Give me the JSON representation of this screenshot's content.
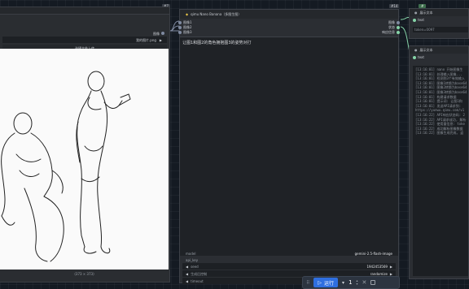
{
  "colors": {
    "accent": "#2f6fe0",
    "bg": "#141a22",
    "node": "#2b2e33",
    "link_green": "#86d4a8",
    "badge_green": "#3f6f4e"
  },
  "badges": {
    "top": "#7",
    "right": "#14",
    "right_small": "#"
  },
  "load_node": {
    "file_value": "我的图片.png",
    "upload_label": "选择文件上传",
    "image_size": "(373 × 373)",
    "edge_label": "图像"
  },
  "nano_node": {
    "title": "qimu Nano Banana（多图生图）",
    "inputs": [
      "图像1",
      "图像2",
      "图像3"
    ],
    "outputs": [
      "图像",
      "状态",
      "响应信息"
    ],
    "prompt": "让图1和图2的角色拥抱图3的姿势对打",
    "params": [
      {
        "label": "model",
        "value": "gemini-2.5-flash-image"
      },
      {
        "label": "api_key",
        "value": ""
      },
      {
        "label": "seed",
        "value": "1942453569"
      },
      {
        "label": "生成后控制",
        "value": "randomize"
      },
      {
        "label": "timeout",
        "value": ""
      }
    ]
  },
  "show_text_1": {
    "title": "展示文本",
    "port": "text",
    "value": "token=0097"
  },
  "show_text_2": {
    "title": "展示文本",
    "port": "text",
    "lines": [
      "[13:16:01] nano 开始图像生",
      "[13:16:01] 处理输入图像...",
      "[13:16:01] 检测到3个有效输入",
      "[13:16:01] 图像1转换为base64",
      "[13:16:01] 图像2转换为base64",
      "[13:16:01] 图像3转换为base64",
      "[13:16:01] 构建请求数据",
      "[13:16:01] 提示词: 让图1和",
      "[13:16:01] 发送API请求到:",
      "https://yunwu.qimu.com/v1",
      "[13:16:22] API响应状态码: 2",
      "[13:16:22] API请求成功, 解析",
      "[13:16:22] 使用量信息: toke",
      "[13:16:22] 成功解析图像数据",
      "[13:16:22] 图像生成完成, 返"
    ]
  },
  "toolbar": {
    "run_label": "运行",
    "count": "1"
  }
}
